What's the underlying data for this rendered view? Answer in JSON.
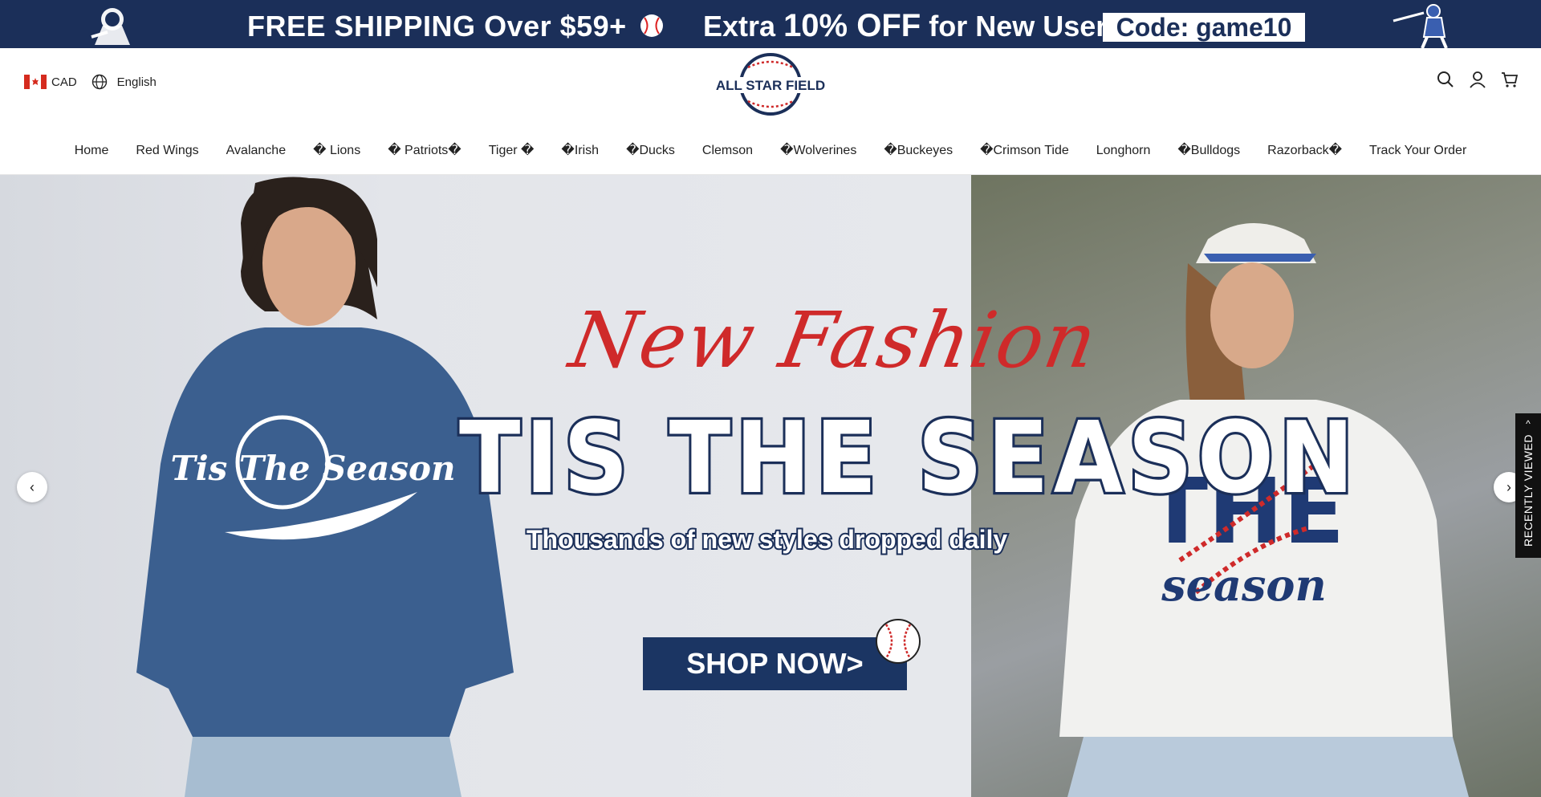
{
  "promo": {
    "shipping_prefix": "FREE SHIPPING",
    "shipping_rest": " Over $59+",
    "extra_prefix": "Extra ",
    "extra_percent": "10% OFF",
    "extra_rest": " for New User",
    "code": "Code: game10"
  },
  "header": {
    "currency": "CAD",
    "language": "English",
    "logo_text": "ALL STAR FIELD"
  },
  "nav": {
    "items": [
      "Home",
      "Red Wings",
      "Avalanche",
      "� Lions",
      "� Patriots�",
      "Tiger �",
      "�Irish",
      "�Ducks",
      "Clemson",
      "�Wolverines",
      "�Buckeyes",
      "�Crimson Tide",
      "Longhorn",
      "�Bulldogs",
      "Razorback�",
      "Track Your Order"
    ]
  },
  "hero": {
    "script_title": "New Fashion",
    "headline": "TIS THE SEASON",
    "tagline": "Thousands of new styles dropped daily",
    "cta": "SHOP NOW>",
    "left_print": "Tis The Season",
    "right_print_top": "THE",
    "right_print_bottom": "season",
    "prev_arrow": "‹",
    "next_arrow": "›"
  },
  "recently_viewed": {
    "label": "RECENTLY VIEWED",
    "chevron": "^"
  },
  "colors": {
    "navy": "#1b2f59",
    "red": "#cf2a2a",
    "white": "#ffffff"
  }
}
